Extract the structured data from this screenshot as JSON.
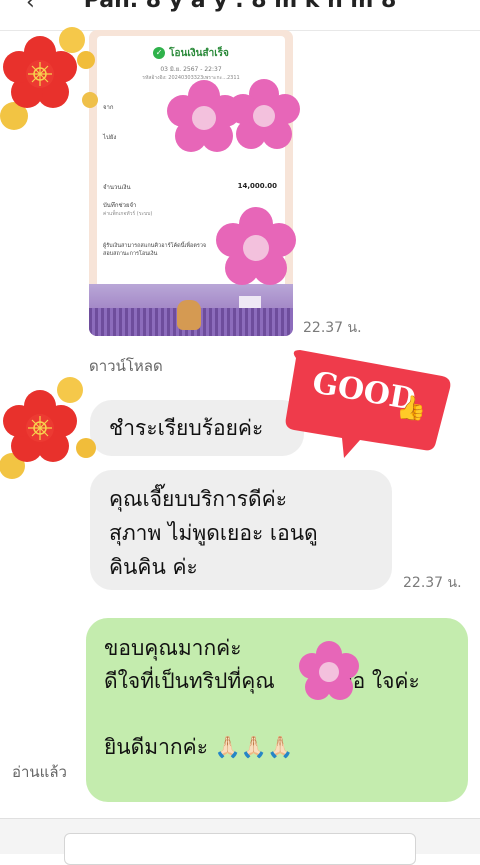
{
  "header": {
    "title": "Pan. 8 y a y . 8 m k n m 8",
    "back_icon": "chevron-left-icon"
  },
  "slip": {
    "status": "โอนเงินสำเร็จ",
    "date": "03 มิ.ย. 2567 - 22:37",
    "ref": "รหัสอ้างอิง: 20240303323เพราะกะ...2311",
    "from_label": "จาก",
    "to_label": "ไปยัง",
    "amount_label": "จำนวนเงิน",
    "amount_value": "14,000.00",
    "note_label": "บันทึกช่วยจำ",
    "note_text": "ค่าแพ็กเกจทัวร์ (ระบบ)",
    "footer_text": "ผู้รับเงินสามารถสแกนคิวอาร์โค้ดนี้เพื่อตรวจสอบสถานะการโอนเงิน"
  },
  "messages": [
    {
      "time": "22.37 น."
    },
    {
      "download": "ดาวน์โหลด"
    },
    {
      "text": "ชำระเรียบร้อยค่ะ"
    },
    {
      "lines": [
        "คุณเจี๊ยบบริการดีค่ะ",
        "สุภาพ ไม่พูดเยอะ เอนดู",
        "คินคิน ค่ะ"
      ],
      "time": "22.37 น."
    },
    {
      "lines": [
        "ขอบคุณมากค่ะ",
        "ดีใจที่เป็นทริปที่คุณ",
        "พอ ใจค่ะ",
        "",
        "ยินดีมากค่ะ 🙏🏻🙏🏻🙏🏻"
      ],
      "read": "อ่านแล้ว"
    }
  ],
  "stickers": {
    "good": "GOOD",
    "thumb_icon": "thumbs-up-icon",
    "flower_icon": "flower-icon"
  },
  "colors": {
    "green_bubble": "#c4ecae",
    "gray_bubble": "#eeeeee",
    "good_red": "#ef3b4b"
  }
}
